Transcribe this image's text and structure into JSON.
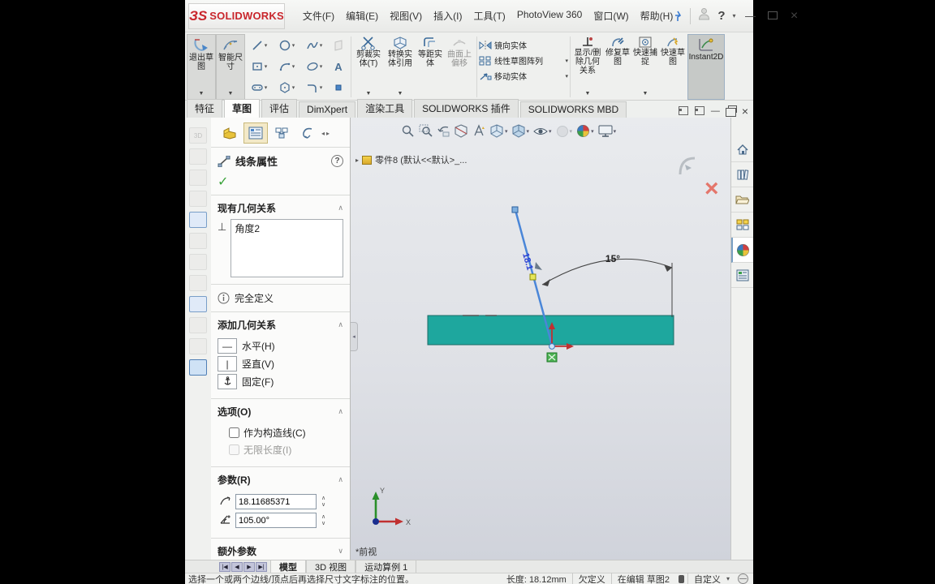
{
  "title_bar": {
    "logo_mark": "ЗS",
    "logo_name": "SOLIDWORKS",
    "menus": [
      "文件(F)",
      "编辑(E)",
      "视图(V)",
      "插入(I)",
      "工具(T)",
      "PhotoView 360",
      "窗口(W)",
      "帮助(H)"
    ],
    "help": "?"
  },
  "ribbon": {
    "exit_sketch": "退出草图",
    "smart_dimension": "智能尺寸",
    "text_icon": "A",
    "trim": "剪裁实体(T)",
    "convert": "转换实体引用",
    "offset": "等距实体",
    "surface_offset": "曲面上偏移",
    "mirror": "镜向实体",
    "linear_pattern": "线性草图阵列",
    "move": "移动实体",
    "display_delete_relations": "显示/删除几何关系",
    "repair_sketch": "修复草图",
    "quick_snaps": "快速捕捉",
    "rapid_sketch": "快速草图",
    "instant2d": "Instant2D"
  },
  "tabs": {
    "items": [
      "特征",
      "草图",
      "评估",
      "DimXpert",
      "渲染工具",
      "SOLIDWORKS 插件",
      "SOLIDWORKS MBD"
    ]
  },
  "left_strip": {
    "first_label": "3D"
  },
  "panel": {
    "title": "线条属性",
    "help": "?",
    "existing_header": "现有几何关系",
    "relation_item": "角度2",
    "status": "完全定义",
    "add_header": "添加几何关系",
    "horizontal": "水平(H)",
    "vertical": "竖直(V)",
    "fix": "固定(F)",
    "options_header": "选项(O)",
    "construction": "作为构造线(C)",
    "infinite": "无限长度(I)",
    "params_header": "参数(R)",
    "length_value": "18.11685371",
    "angle_value": "105.00°",
    "extra_header": "额外参数"
  },
  "viewport": {
    "doc_label": "零件8 (默认<<默认>_...",
    "angle_dim": "15°",
    "length_dim": "18.1",
    "view_label": "*前视",
    "axis_x": "X",
    "axis_y": "Y"
  },
  "bottom_tabs": {
    "items": [
      "模型",
      "3D 视图",
      "运动算例 1"
    ]
  },
  "status": {
    "message": "选择一个或两个边线/顶点后再选择尺寸文字标注的位置。",
    "length": "长度: 18.12mm",
    "defined_state": "欠定义",
    "editing": "在编辑 草图2",
    "unit": "自定义"
  },
  "colors": {
    "sketch_teal": "#1ea79e",
    "sketch_blue": "#4a86d8",
    "origin_red": "#c03030",
    "fixed_green": "#4db254",
    "close_red": "#e4766b"
  }
}
